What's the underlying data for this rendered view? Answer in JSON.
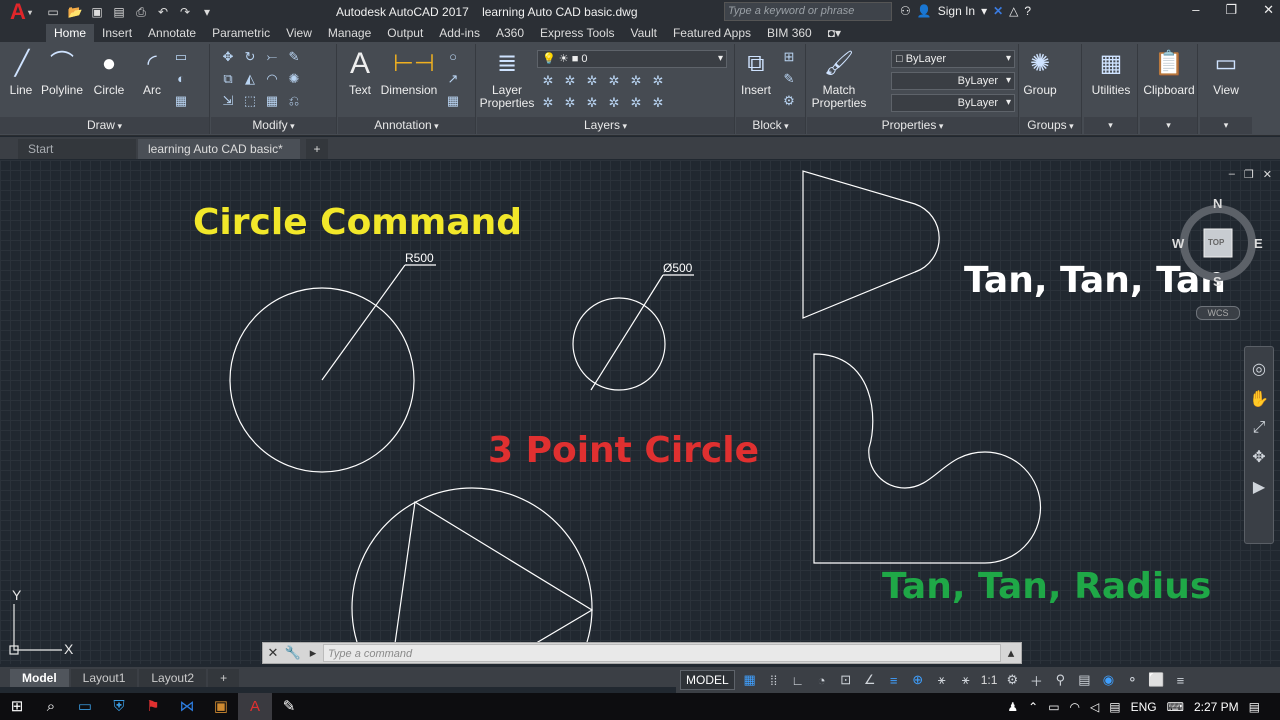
{
  "app": {
    "window_title": "Autodesk AutoCAD 2017    learning Auto CAD basic.dwg",
    "search_placeholder": "Type a keyword or phrase",
    "sign_in": "Sign In"
  },
  "ribbon_tabs": [
    "Home",
    "Insert",
    "Annotate",
    "Parametric",
    "View",
    "Manage",
    "Output",
    "Add-ins",
    "A360",
    "Express Tools",
    "Vault",
    "Featured Apps",
    "BIM 360"
  ],
  "ribbon": {
    "draw": {
      "title": "Draw",
      "buttons": [
        "Line",
        "Polyline",
        "Circle",
        "Arc"
      ]
    },
    "modify": {
      "title": "Modify"
    },
    "annotation": {
      "title": "Annotation",
      "text_label": "Text",
      "dimension_label": "Dimension"
    },
    "layers": {
      "title": "Layers",
      "layer_properties": "Layer\nProperties",
      "current_layer": "0"
    },
    "block": {
      "title": "Block",
      "insert_label": "Insert"
    },
    "properties": {
      "title": "Properties",
      "match_label": "Match\nProperties",
      "color": "ByLayer",
      "linetype": "ByLayer",
      "lineweight": "ByLayer"
    },
    "groups": {
      "title": "Groups",
      "group_label": "Group"
    },
    "utilities_label": "Utilities",
    "clipboard_label": "Clipboard",
    "view_label": "View"
  },
  "file_tabs": {
    "start": "Start",
    "document": "learning Auto CAD basic*"
  },
  "canvas": {
    "annotations": {
      "circle_command": "Circle Command",
      "three_point": "3 Point Circle",
      "tan_tan_tan": "Tan, Tan, Tan",
      "tan_tan_radius": "Tan, Tan, Radius"
    },
    "dims": {
      "radius": "R500",
      "diameter": "Ø500"
    },
    "viewcube": {
      "n": "N",
      "s": "S",
      "e": "E",
      "w": "W",
      "face": "TOP",
      "wcs": "WCS"
    },
    "ucs": {
      "x": "X",
      "y": "Y"
    },
    "colors": {
      "yellow": "#f2e82a",
      "red": "#e03030",
      "white": "#ffffff",
      "green": "#1fa847"
    }
  },
  "command_line": {
    "placeholder": "Type a command"
  },
  "layout_tabs": [
    "Model",
    "Layout1",
    "Layout2"
  ],
  "status": {
    "model": "MODEL",
    "scale": "1:1"
  },
  "taskbar": {
    "lang": "ENG",
    "time": "2:27 PM"
  }
}
